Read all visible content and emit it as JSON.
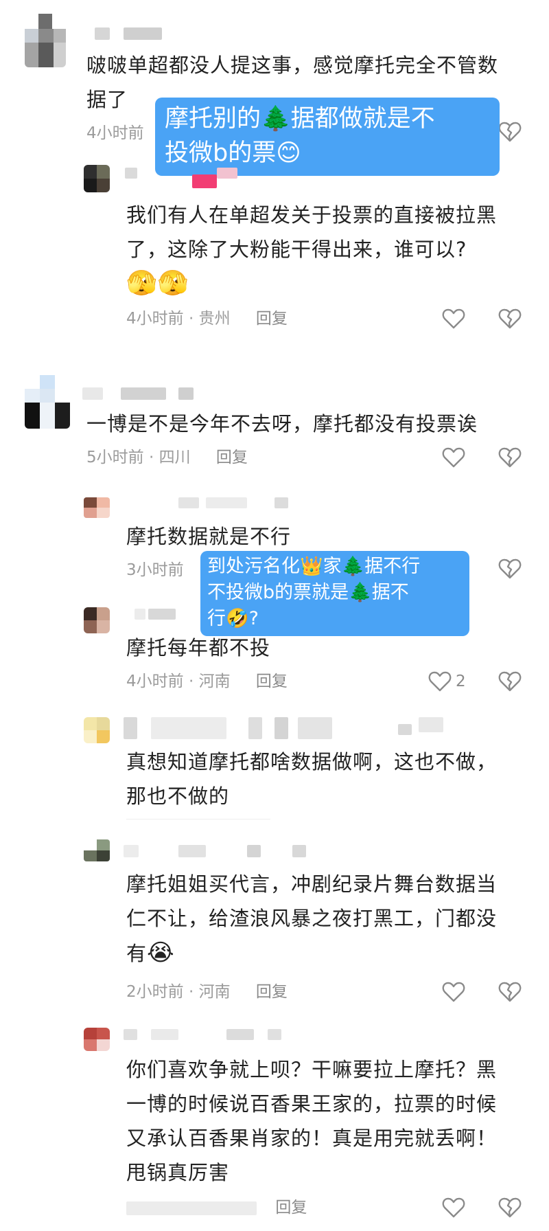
{
  "comments": [
    {
      "text_lines": [
        "啵啵单超都没人提这事，感觉摩托完全不管数",
        "据了"
      ],
      "time": "4小时前"
    },
    {
      "text_lines": [
        "我们有人在单超发关于投票的直接被拉黑",
        "了，这除了大粉能干得出来，谁可以?"
      ],
      "emoji": "🫣🫣",
      "time": "4小时前",
      "sep": "·",
      "location": "贵州",
      "reply": "回复"
    },
    {
      "text_lines": [
        "一博是不是今年不去呀，摩托都没有投票诶"
      ],
      "time": "5小时前",
      "sep": "·",
      "location": "四川",
      "reply": "回复"
    },
    {
      "text_lines": [
        "摩托数据就是不行"
      ],
      "time": "3小时前"
    },
    {
      "text_lines": [
        "摩托每年都不投"
      ],
      "time": "4小时前",
      "sep": "·",
      "location": "河南",
      "reply": "回复",
      "like_count": "2"
    },
    {
      "text_lines": [
        "真想知道摩托都啥数据做啊，这也不做，",
        "那也不做的"
      ]
    },
    {
      "text_lines": [
        "摩托姐姐买代言，冲剧纪录片舞台数据当",
        "仁不让，给渣浪风暴之夜打黑工，门都没",
        "有"
      ],
      "emoji": "😭",
      "time": "2小时前",
      "sep": "·",
      "location": "河南",
      "reply": "回复"
    },
    {
      "text_lines": [
        "你们喜欢争就上呗？干嘛要拉上摩托？黑",
        "一博的时候说百香果王家的，拉票的时候",
        "又承认百香果肖家的！真是用完就丢啊！",
        "甩锅真厉害"
      ],
      "reply": "回复"
    }
  ],
  "overlays": [
    {
      "lines": [
        "摩托别的🌲据都做就是不",
        "投微b的票😊"
      ]
    },
    {
      "lines": [
        "到处污名化👑家🌲据不行",
        "不投微b的票就是🌲据不",
        "行🤣?"
      ]
    }
  ],
  "icons": {
    "like": "heart-outline-icon",
    "dislike": "broken-heart-icon"
  },
  "colors": {
    "overlay_bg": "#4aa3f5",
    "meta": "#9b9b9b"
  }
}
